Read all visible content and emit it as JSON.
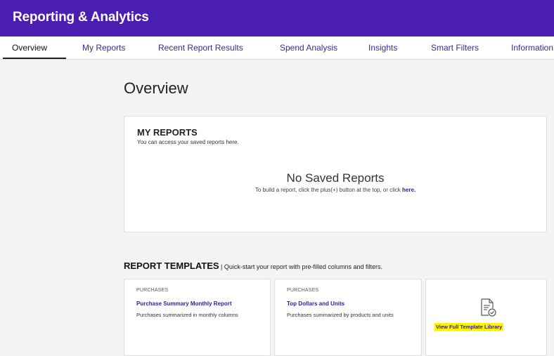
{
  "app": {
    "title": "Reporting & Analytics"
  },
  "tabs": [
    {
      "label": "Overview"
    },
    {
      "label": "My Reports"
    },
    {
      "label": "Recent Report Results"
    },
    {
      "label": "Spend Analysis"
    },
    {
      "label": "Insights"
    },
    {
      "label": "Smart Filters"
    },
    {
      "label": "Information"
    }
  ],
  "main": {
    "title": "Overview",
    "my_reports": {
      "heading": "MY REPORTS",
      "subtitle": "You can access your saved reports here.",
      "empty_title": "No Saved Reports",
      "empty_text": "To build a report, click the plus(+) button at the top, or click",
      "empty_link": "here."
    },
    "templates": {
      "heading": "REPORT TEMPLATES",
      "separator": " | ",
      "description": "Quick-start your report with pre-filled columns and filters.",
      "cards": [
        {
          "category": "PURCHASES",
          "name": "Purchase Summary Monthly Report",
          "description": "Purchases summarized in monthly columns"
        },
        {
          "category": "PURCHASES",
          "name": "Top Dollars and Units",
          "description": "Purchases summarized by products and units"
        }
      ],
      "library_link": "View Full Template Library",
      "library_icon": "document-check-icon"
    }
  },
  "colors": {
    "brand": "#4a1eb0",
    "link": "#2f1e9a",
    "highlight": "#fff200"
  }
}
